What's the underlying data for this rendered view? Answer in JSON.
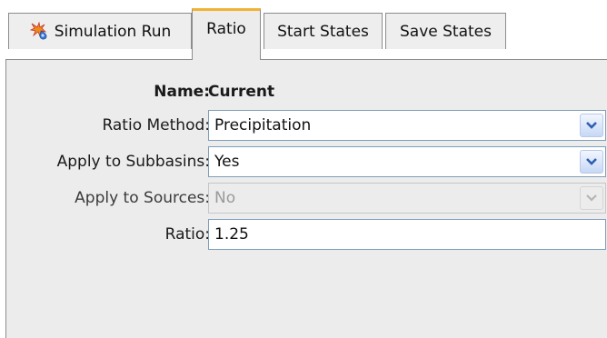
{
  "tabs": [
    {
      "label": "Simulation Run",
      "icon": "simulation-run-icon",
      "active": false
    },
    {
      "label": "Ratio",
      "active": true
    },
    {
      "label": "Start States",
      "active": false
    },
    {
      "label": "Save States",
      "active": false
    }
  ],
  "form": {
    "name_label": "Name:",
    "name_value": "Current",
    "ratio_method_label": "Ratio Method:",
    "ratio_method_value": "Precipitation",
    "apply_subbasins_label": "Apply to Subbasins:",
    "apply_subbasins_value": "Yes",
    "apply_sources_label": "Apply to Sources:",
    "apply_sources_value": "No",
    "ratio_label": "Ratio:",
    "ratio_value": "1.25"
  },
  "colors": {
    "active_tab_accent": "#f2b233",
    "panel_bg": "#ececec",
    "dropdown_arrow": "#2f5fb3",
    "disabled_text": "#9a9a9a"
  }
}
